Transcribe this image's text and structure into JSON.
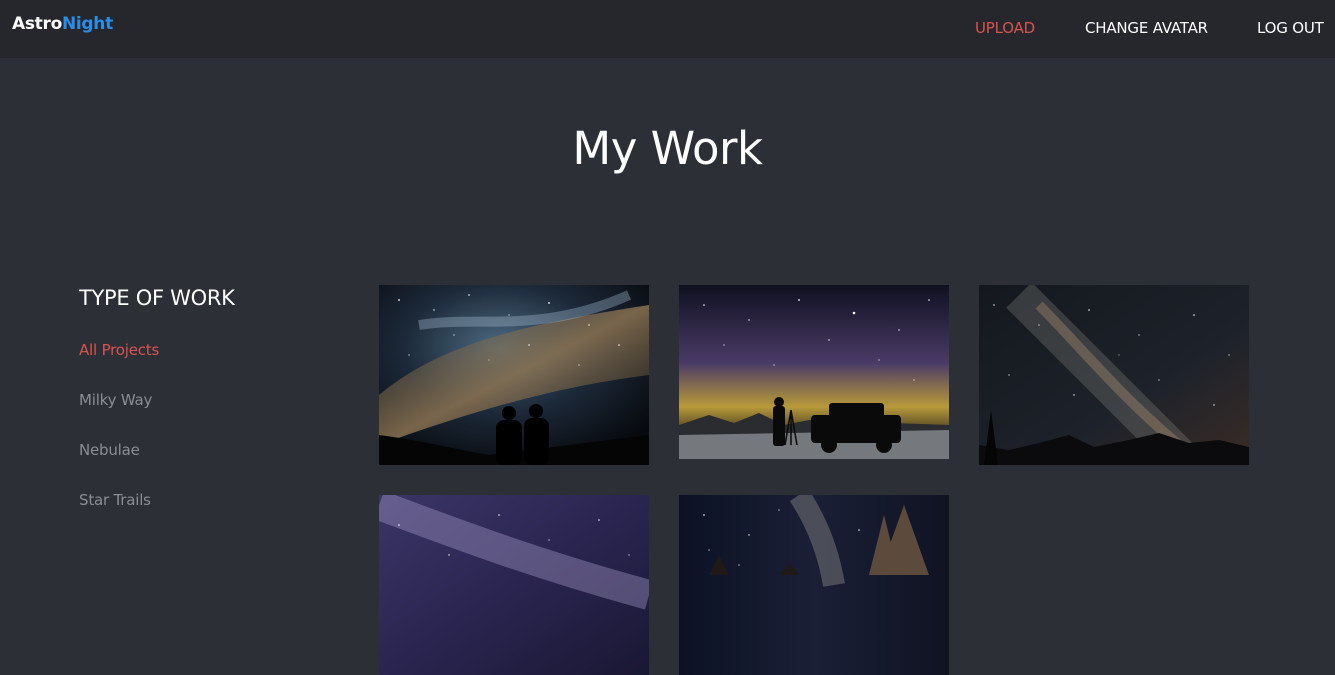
{
  "navbar": {
    "brand": {
      "part1": "Astro",
      "part2": "Night"
    },
    "links": [
      {
        "label": "UPLOAD",
        "active": true
      },
      {
        "label": "CHANGE AVATAR",
        "active": false
      },
      {
        "label": "LOG OUT",
        "active": false
      }
    ]
  },
  "page": {
    "title": "My Work"
  },
  "filters": {
    "heading": "TYPE OF WORK",
    "items": [
      {
        "label": "All Projects",
        "active": true
      },
      {
        "label": "Milky Way",
        "active": false
      },
      {
        "label": "Nebulae",
        "active": false
      },
      {
        "label": "Star Trails",
        "active": false
      }
    ]
  },
  "colors": {
    "background": "#2d2f36",
    "navbar": "#25272c",
    "accent_blue": "#2a8ee8",
    "accent_red": "#d9534f",
    "muted_text": "#8a8d94"
  },
  "gallery": [
    {
      "icon": "milky-way-silhouettes-photo"
    },
    {
      "icon": "night-sky-car-photographer-photo"
    },
    {
      "icon": "milky-way-mountains-photo"
    },
    {
      "icon": "purple-milky-way-photo"
    },
    {
      "icon": "milky-way-trees-photo"
    }
  ]
}
